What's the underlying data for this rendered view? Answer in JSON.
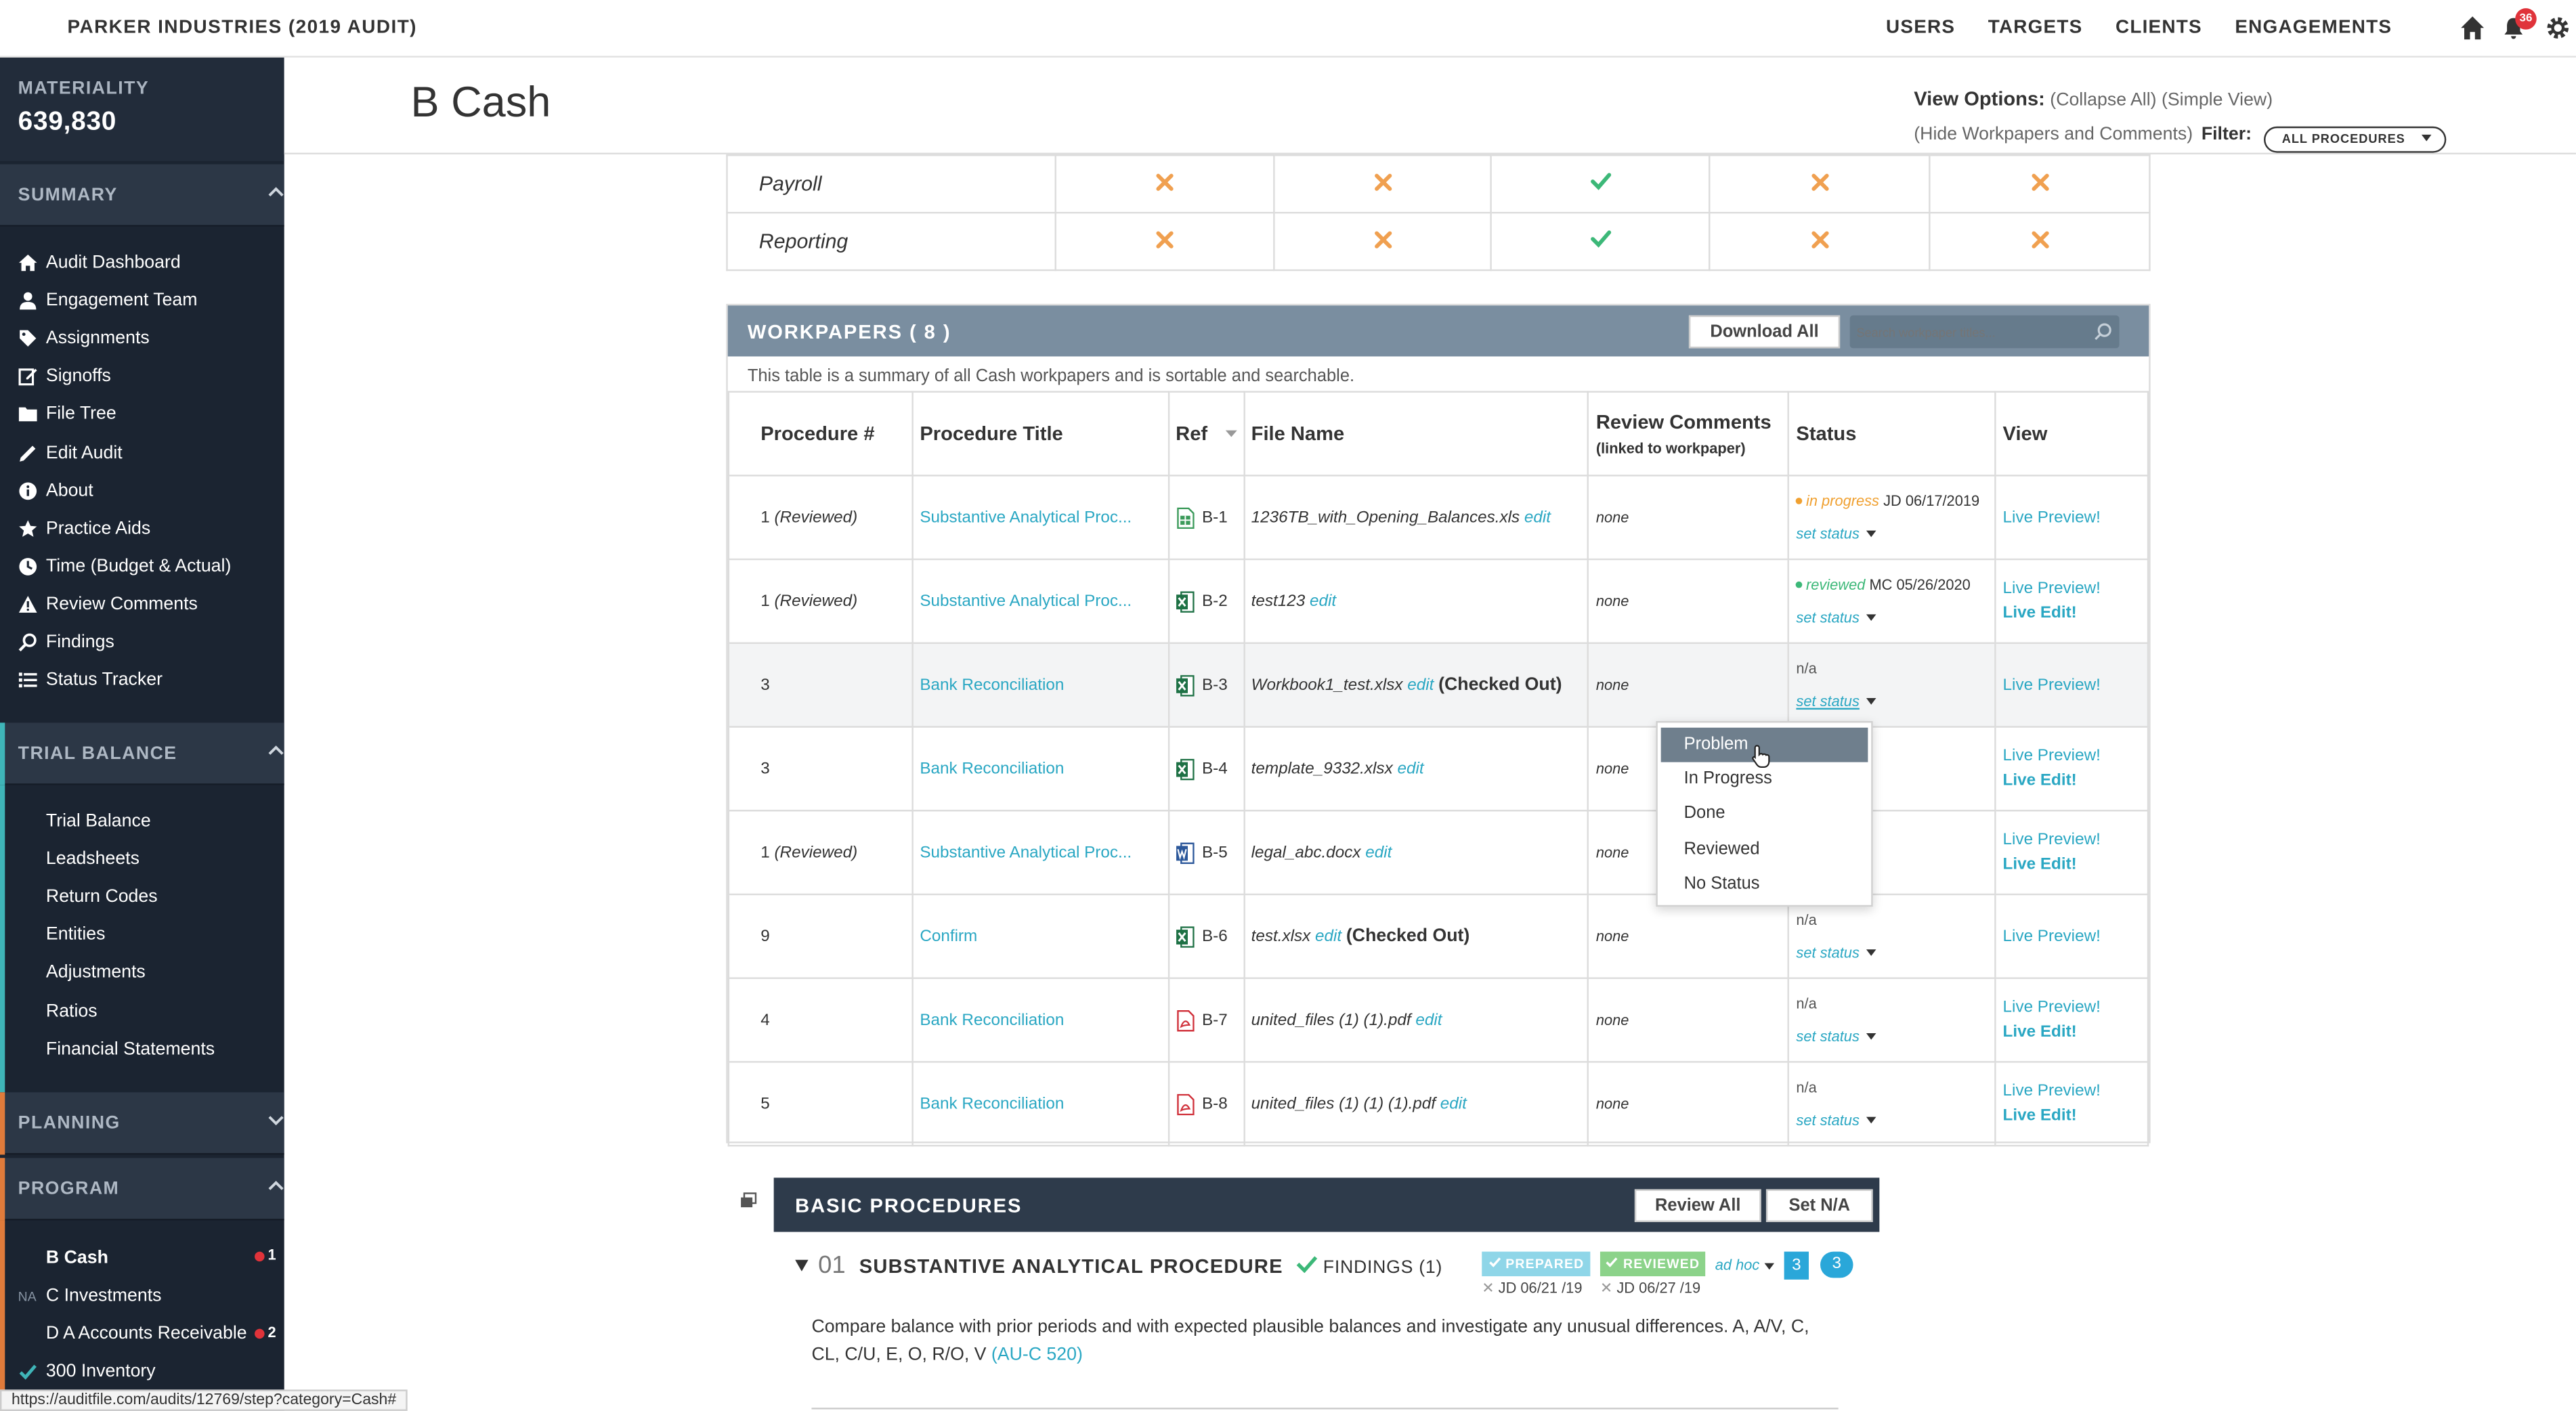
{
  "app": {
    "title": "PARKER INDUSTRIES (2019 AUDIT)",
    "notifications": "36"
  },
  "topnav": [
    "USERS",
    "TARGETS",
    "CLIENTS",
    "ENGAGEMENTS"
  ],
  "sidebar": {
    "materiality_label": "MATERIALITY",
    "materiality_value": "639,830",
    "summary_label": "SUMMARY",
    "summary_items": [
      "Audit Dashboard",
      "Engagement Team",
      "Assignments",
      "Signoffs",
      "File Tree",
      "Edit Audit",
      "About",
      "Practice Aids",
      "Time (Budget & Actual)",
      "Review Comments",
      "Findings",
      "Status Tracker"
    ],
    "trial_balance_label": "TRIAL BALANCE",
    "trial_balance_items": [
      "Trial Balance",
      "Leadsheets",
      "Return Codes",
      "Entities",
      "Adjustments",
      "Ratios",
      "Financial Statements"
    ],
    "planning_label": "PLANNING",
    "program_label": "PROGRAM",
    "program_items": [
      {
        "label": "B Cash",
        "prefix": "",
        "count": "1"
      },
      {
        "label": "C Investments",
        "prefix": "NA",
        "count": ""
      },
      {
        "label": "D A Accounts Receivable",
        "prefix": "",
        "count": "2"
      },
      {
        "label": "300 Inventory",
        "prefix": "",
        "count": ""
      }
    ]
  },
  "page": {
    "title": "B Cash",
    "view_options_label": "View Options:",
    "collapse_all": "(Collapse All)",
    "simple_view": "(Simple View)",
    "hide_workpapers": "(Hide Workpapers and Comments)",
    "filter_label": "Filter:",
    "filter_value": "ALL PROCEDURES"
  },
  "top_rows": [
    {
      "name": "Payroll",
      "cells": [
        "x",
        "x",
        "check",
        "x",
        "x"
      ]
    },
    {
      "name": "Reporting",
      "cells": [
        "x",
        "x",
        "check",
        "x",
        "x"
      ]
    }
  ],
  "workpapers": {
    "title": "WORKPAPERS ( 8 )",
    "download_all": "Download All",
    "search_placeholder": "Search workpaper titles...",
    "description": "This table is a summary of all Cash workpapers and is sortable and searchable.",
    "headers": {
      "procedure": "Procedure #",
      "title": "Procedure Title",
      "ref": "Ref",
      "file": "File Name",
      "review": "Review Comments",
      "review_sub": "(linked to workpaper)",
      "status": "Status",
      "view": "View"
    },
    "rows": [
      {
        "proc": "1",
        "proc_note": "(Reviewed)",
        "title": "Substantive Analytical Proc...",
        "icon": "sheet-green",
        "ref": "B-1",
        "file": "1236TB_with_Opening_Balances.xls",
        "edit": "edit",
        "checked_out": "",
        "comments": "none",
        "status_dot": "#f0a030",
        "status_text": "in progress",
        "status_by": "JD 06/17/2019",
        "set_status": "set status",
        "preview": "Live Preview!",
        "live_edit": ""
      },
      {
        "proc": "1",
        "proc_note": "(Reviewed)",
        "title": "Substantive Analytical Proc...",
        "icon": "excel",
        "ref": "B-2",
        "file": "test123",
        "edit": "edit",
        "checked_out": "",
        "comments": "none",
        "status_dot": "#3cb878",
        "status_text": "reviewed",
        "status_by": "MC 05/26/2020",
        "set_status": "set status",
        "preview": "Live Preview!",
        "live_edit": "Live Edit!"
      },
      {
        "proc": "3",
        "proc_note": "",
        "title": "Bank Reconciliation",
        "icon": "excel",
        "ref": "B-3",
        "file": "Workbook1_test.xlsx",
        "edit": "edit",
        "checked_out": "(Checked Out)",
        "comments": "none",
        "status_dot": "",
        "status_text": "n/a",
        "status_by": "",
        "set_status": "set status",
        "preview": "Live Preview!",
        "live_edit": ""
      },
      {
        "proc": "3",
        "proc_note": "",
        "title": "Bank Reconciliation",
        "icon": "excel",
        "ref": "B-4",
        "file": "template_9332.xlsx",
        "edit": "edit",
        "checked_out": "",
        "comments": "none",
        "status_dot": "",
        "status_text": "",
        "status_by": "",
        "set_status": "",
        "preview": "Live Preview!",
        "live_edit": "Live Edit!"
      },
      {
        "proc": "1",
        "proc_note": "(Reviewed)",
        "title": "Substantive Analytical Proc...",
        "icon": "word",
        "ref": "B-5",
        "file": "legal_abc.docx",
        "edit": "edit",
        "checked_out": "",
        "comments": "none",
        "status_dot": "",
        "status_text": "",
        "status_by": "",
        "set_status": "",
        "preview": "Live Preview!",
        "live_edit": "Live Edit!"
      },
      {
        "proc": "9",
        "proc_note": "",
        "title": "Confirm",
        "icon": "excel",
        "ref": "B-6",
        "file": "test.xlsx",
        "edit": "edit",
        "checked_out": "(Checked Out)",
        "comments": "none",
        "status_dot": "",
        "status_text": "n/a",
        "status_by": "",
        "set_status": "set status",
        "preview": "Live Preview!",
        "live_edit": ""
      },
      {
        "proc": "4",
        "proc_note": "",
        "title": "Bank Reconciliation",
        "icon": "pdf",
        "ref": "B-7",
        "file": "united_files (1) (1).pdf",
        "edit": "edit",
        "checked_out": "",
        "comments": "none",
        "status_dot": "",
        "status_text": "n/a",
        "status_by": "",
        "set_status": "set status",
        "preview": "Live Preview!",
        "live_edit": "Live Edit!"
      },
      {
        "proc": "5",
        "proc_note": "",
        "title": "Bank Reconciliation",
        "icon": "pdf",
        "ref": "B-8",
        "file": "united_files (1) (1) (1).pdf",
        "edit": "edit",
        "checked_out": "",
        "comments": "none",
        "status_dot": "",
        "status_text": "n/a",
        "status_by": "",
        "set_status": "set status",
        "preview": "Live Preview!",
        "live_edit": "Live Edit!"
      }
    ]
  },
  "status_dropdown": {
    "options": [
      "Problem",
      "In Progress",
      "Done",
      "Reviewed",
      "No Status"
    ],
    "selected": "Problem"
  },
  "basic_procedures": {
    "title": "BASIC PROCEDURES",
    "review_all": "Review All",
    "set_na": "Set N/A",
    "procedure": {
      "number": "01",
      "title": "SUBSTANTIVE ANALYTICAL PROCEDURE",
      "findings": "FINDINGS (1)",
      "prepared": "PREPARED",
      "prepared_by": "JD 06/21 /19",
      "reviewed": "REVIEWED",
      "reviewed_by": "JD 06/27 /19",
      "adhoc": "ad hoc",
      "count_square": "3",
      "count_bubble": "3",
      "description": "Compare balance with prior periods and with expected plausible balances and investigate any unusual differences. A, A/V, C, CL, C/U, E, O, R/O, V",
      "link": "(AU-C 520)"
    }
  },
  "status_bar_url": "https://auditfile.com/audits/12769/step?category=Cash#",
  "colors": {
    "sidebar": "#1b2431",
    "accent": "#2aa7c3",
    "header_band": "#7a8ea0",
    "x_mark": "#f0a050",
    "check_mark": "#3cb878",
    "trial_balance_bar": "#3fb5b8",
    "planning_bar": "#e07b3b",
    "program_bar": "#e07b3b"
  }
}
